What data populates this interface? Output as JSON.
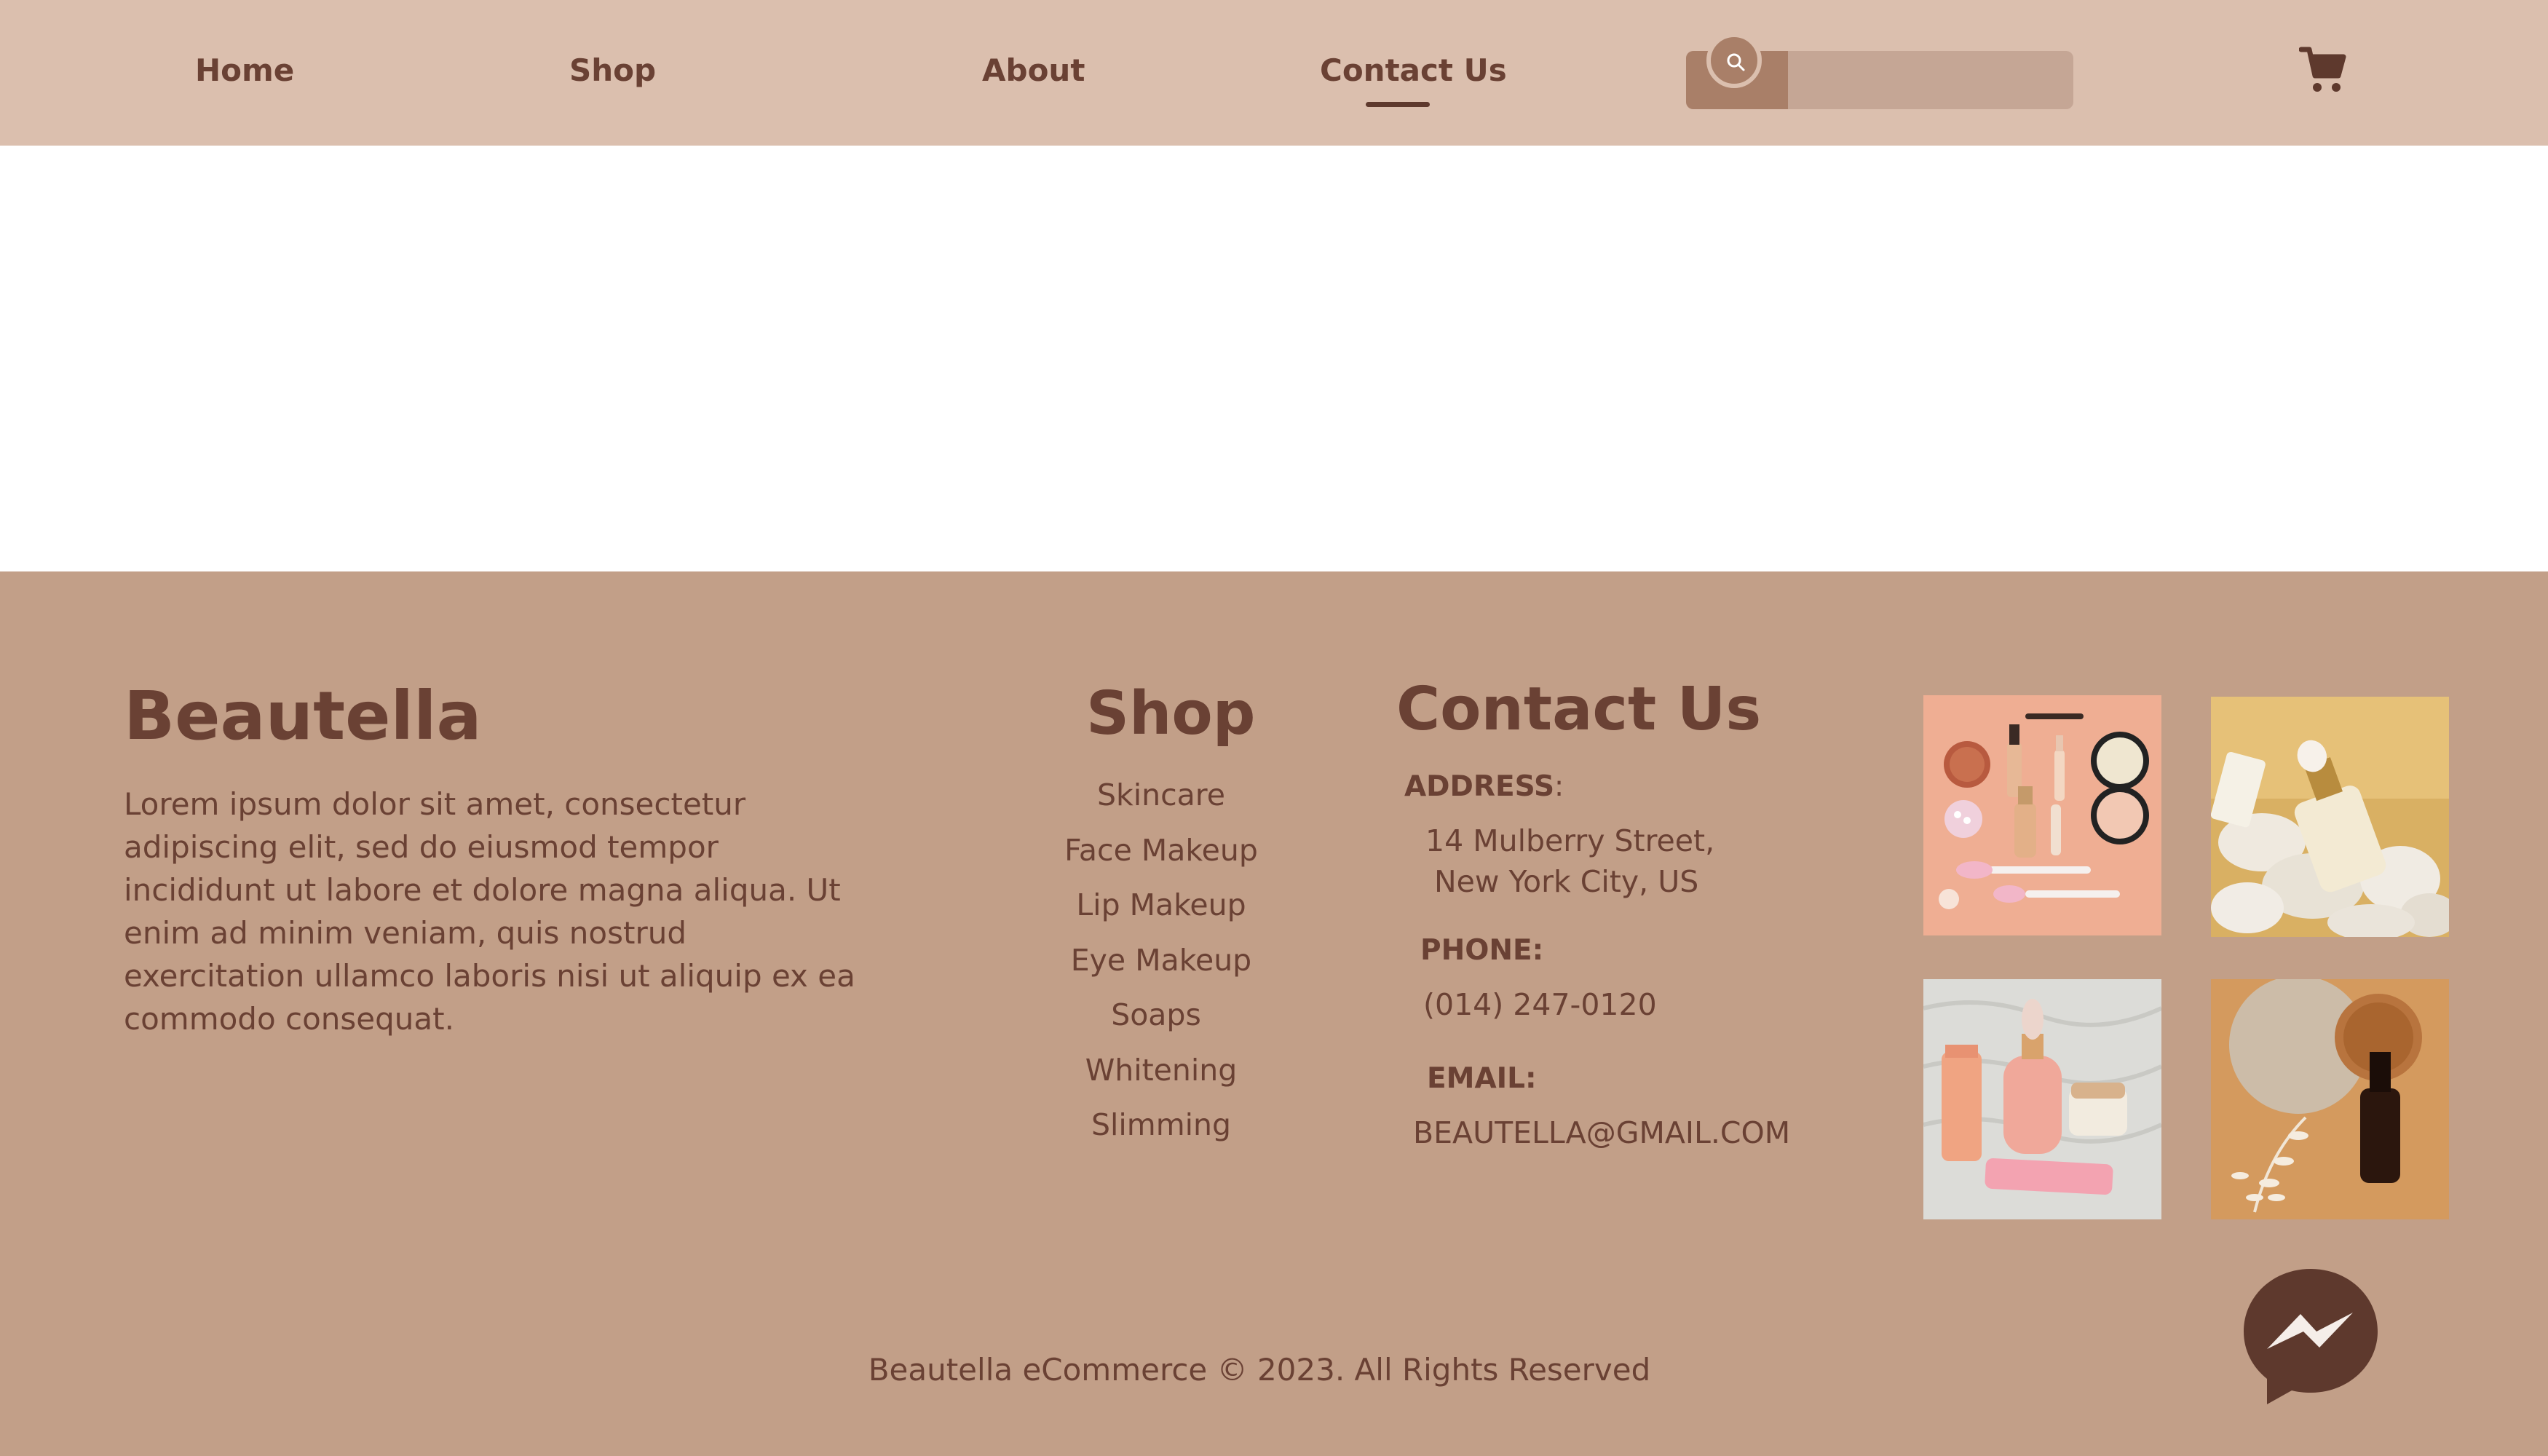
{
  "nav": {
    "items": [
      {
        "label": "Home"
      },
      {
        "label": "Shop"
      },
      {
        "label": "About"
      },
      {
        "label": "Contact Us",
        "active": true
      }
    ],
    "search": {
      "placeholder": "",
      "icon": "search-icon"
    },
    "cart_icon": "cart-icon"
  },
  "footer": {
    "brand": "Beautella",
    "about": "Lorem ipsum dolor sit amet, consectetur adipiscing elit, sed do eiusmod tempor incididunt ut labore et dolore magna aliqua. Ut enim ad minim veniam, quis nostrud exercitation ullamco laboris nisi ut aliquip ex ea commodo consequat.",
    "shop": {
      "title": "Shop",
      "links": [
        "Skincare",
        "Face Makeup",
        "Lip Makeup",
        "Eye Makeup",
        "Soaps",
        "Whitening",
        "Slimming"
      ]
    },
    "contact": {
      "title": "Contact Us",
      "address_label": "ADDRESS",
      "address_line1": "14 Mulberry Street,",
      "address_line2": "New York City, US",
      "phone_label": "PHONE:",
      "phone": "(014) 247-0120",
      "email_label": "EMAIL:",
      "email": "BEAUTELLA@GMAIL.COM"
    },
    "copyright": "Beautella eCommerce © 2023. All Rights Reserved",
    "messenger_icon": "messenger-icon"
  },
  "colors": {
    "header_bg": "#dbbfae",
    "footer_bg": "#c29f88",
    "text_brown": "#6a4134",
    "accent": "#a97f68"
  }
}
